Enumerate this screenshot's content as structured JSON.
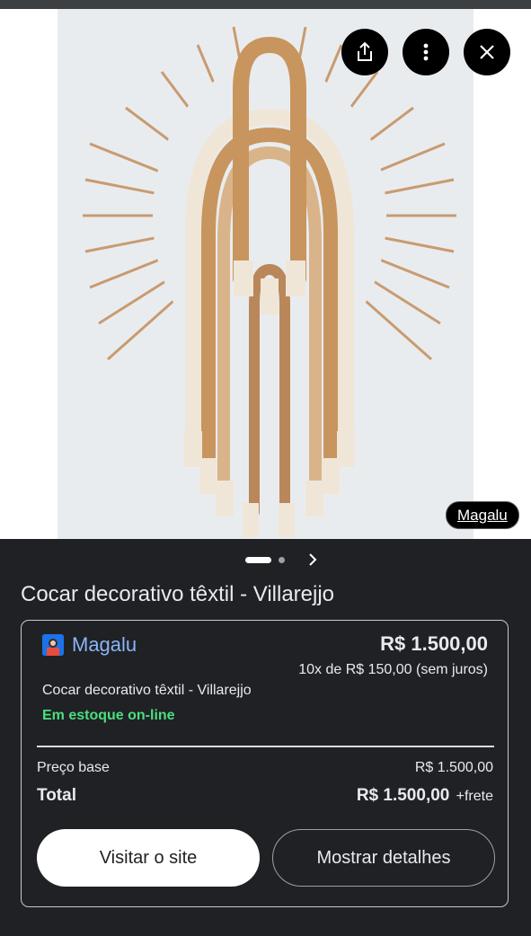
{
  "image": {
    "source_label": "Magalu",
    "description_icon": "cocar-product-image"
  },
  "actions": {
    "share_icon": "share-icon",
    "more_icon": "more-vert-icon",
    "close_icon": "close-icon"
  },
  "product": {
    "title": "Cocar decorativo têxtil - Villarejjo"
  },
  "offer": {
    "seller": "Magalu",
    "price": "R$ 1.500,00",
    "installments": "10x de R$ 150,00 (sem juros)",
    "product_name": "Cocar decorativo têxtil - Villarejjo",
    "stock_status": "Em estoque on-line",
    "base_label": "Preço base",
    "base_value": "R$ 1.500,00",
    "total_label": "Total",
    "total_value": "R$ 1.500,00",
    "shipping_note": "+frete"
  },
  "buttons": {
    "visit": "Visitar o site",
    "details": "Mostrar detalhes"
  },
  "colors": {
    "accent_link": "#8ab4f8",
    "stock_green": "#4ade80",
    "background": "#202124"
  }
}
